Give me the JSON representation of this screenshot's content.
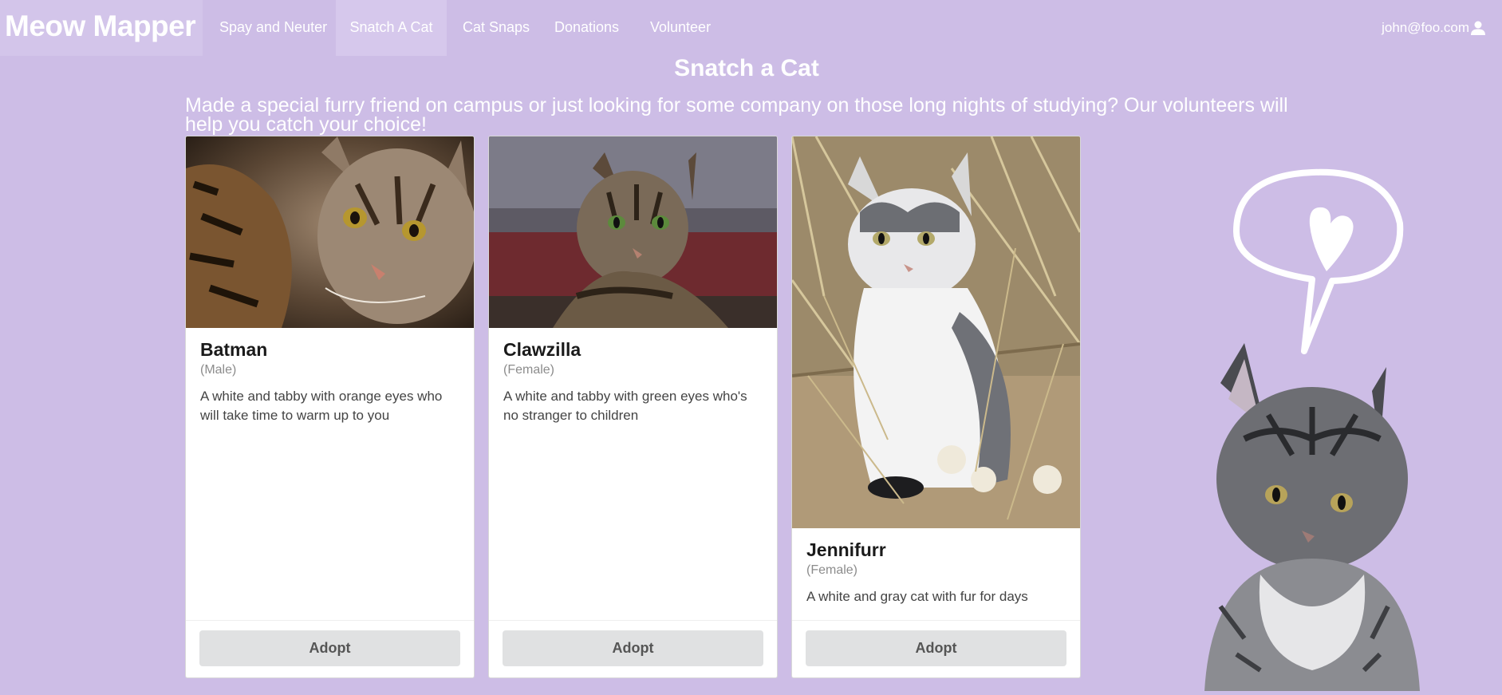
{
  "nav": {
    "brand": "Meow Mapper",
    "items": [
      {
        "label": "Spay and Neuter"
      },
      {
        "label": "Snatch A Cat",
        "active": true
      },
      {
        "label": "Cat Snaps"
      },
      {
        "label": "Donations"
      },
      {
        "label": "Volunteer"
      }
    ],
    "user": "john@foo.com",
    "user_icon": "user-icon"
  },
  "page": {
    "title": "Snatch a Cat",
    "intro": "Made a special furry friend on campus or just looking for some company on those long nights of studying? Our volunteers will help you catch your choice!"
  },
  "cats": [
    {
      "name": "Batman",
      "sex": "(Male)",
      "description": "A white and tabby with orange eyes who will take time to warm up to you",
      "button": "Adopt"
    },
    {
      "name": "Clawzilla",
      "sex": "(Female)",
      "description": "A white and tabby with green eyes who's no stranger to children",
      "button": "Adopt"
    },
    {
      "name": "Jennifurr",
      "sex": "(Female)",
      "description": "A white and gray cat with fur for days",
      "button": "Adopt"
    }
  ],
  "colors": {
    "background": "#cdbde6",
    "text_light": "#ffffff",
    "button": "#e0e1e2"
  },
  "decoration": {
    "icons": [
      "heart-icon",
      "speech-bubble-icon"
    ]
  }
}
